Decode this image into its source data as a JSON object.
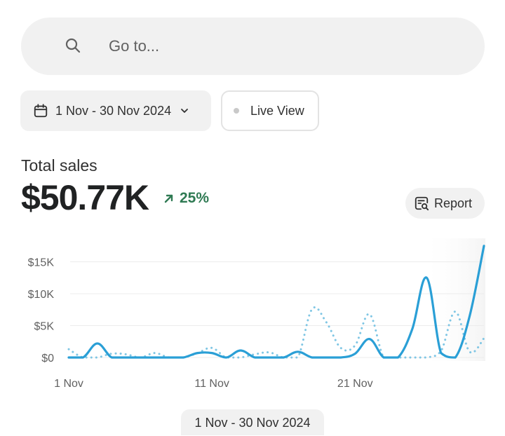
{
  "search": {
    "placeholder": "Go to...",
    "icon": "search-icon"
  },
  "filters": {
    "date_range": "1 Nov - 30 Nov 2024",
    "live_view": "Live View"
  },
  "metric": {
    "label": "Total sales",
    "value": "$50.77K",
    "change": "25%",
    "change_color": "#2f7a53"
  },
  "report_button": {
    "label": "Report",
    "icon": "report-search-icon"
  },
  "chart_data": {
    "type": "line",
    "title": "",
    "xlabel": "",
    "ylabel": "",
    "x_ticks": [
      "1 Nov",
      "11 Nov",
      "21 Nov"
    ],
    "y_ticks": [
      "$0",
      "$5K",
      "$10K",
      "$15K"
    ],
    "ylim": [
      0,
      18000
    ],
    "grid": true,
    "x": [
      1,
      2,
      3,
      4,
      5,
      6,
      7,
      8,
      9,
      10,
      11,
      12,
      13,
      14,
      15,
      16,
      17,
      18,
      19,
      20,
      21,
      22,
      23,
      24,
      25,
      26,
      27,
      28,
      29,
      30
    ],
    "series": [
      {
        "style": "solid",
        "color": "#2a9fd6",
        "values": [
          0,
          0,
          2200,
          0,
          0,
          0,
          0,
          0,
          0,
          700,
          700,
          0,
          1100,
          0,
          0,
          0,
          900,
          0,
          0,
          0,
          600,
          2900,
          0,
          0,
          4500,
          12500,
          700,
          0,
          6500,
          17500
        ]
      },
      {
        "style": "dotted",
        "color": "#7fc6e4",
        "values": [
          1300,
          0,
          0,
          600,
          500,
          0,
          700,
          0,
          0,
          700,
          1500,
          0,
          0,
          500,
          800,
          0,
          0,
          7600,
          5500,
          1500,
          1900,
          6800,
          0,
          0,
          0,
          0,
          1000,
          7200,
          900,
          3000
        ]
      }
    ]
  },
  "footer": {
    "date_range": "1 Nov - 30 Nov 2024"
  }
}
